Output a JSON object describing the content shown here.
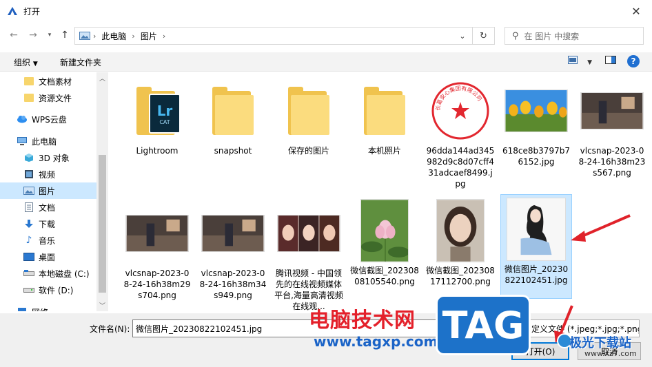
{
  "window": {
    "title": "打开"
  },
  "address": {
    "segments": [
      "此电脑",
      "图片"
    ]
  },
  "search": {
    "placeholder": "在 图片 中搜索"
  },
  "toolbar": {
    "organize": "组织",
    "new_folder": "新建文件夹"
  },
  "sidebar": {
    "items": [
      {
        "label": "文档素材",
        "icon": "folder-icon"
      },
      {
        "label": "资源文件",
        "icon": "folder-icon"
      },
      {
        "label": "WPS云盘",
        "icon": "cloud-icon"
      },
      {
        "label": "此电脑",
        "icon": "computer-icon"
      },
      {
        "label": "3D 对象",
        "icon": "cube-icon"
      },
      {
        "label": "视频",
        "icon": "video-icon"
      },
      {
        "label": "图片",
        "icon": "pictures-icon",
        "selected": true
      },
      {
        "label": "文档",
        "icon": "document-icon"
      },
      {
        "label": "下载",
        "icon": "download-icon"
      },
      {
        "label": "音乐",
        "icon": "music-icon"
      },
      {
        "label": "桌面",
        "icon": "desktop-icon"
      },
      {
        "label": "本地磁盘 (C:)",
        "icon": "drive-icon"
      },
      {
        "label": "软件 (D:)",
        "icon": "drive-icon"
      },
      {
        "label": "网络",
        "icon": "network-icon"
      }
    ]
  },
  "files": [
    {
      "label": "Lightroom",
      "kind": "folder-lr"
    },
    {
      "label": "snapshot",
      "kind": "folder"
    },
    {
      "label": "保存的图片",
      "kind": "folder"
    },
    {
      "label": "本机照片",
      "kind": "folder"
    },
    {
      "label": "96dda144ad345982d9c8d07cff431adcaef8499.jpg",
      "kind": "seal"
    },
    {
      "label": "618ce8b3797b76152.jpg",
      "kind": "tulips"
    },
    {
      "label": "vlcsnap-2023-08-24-16h38m23s567.png",
      "kind": "room"
    },
    {
      "label": "vlcsnap-2023-08-24-16h38m29s704.png",
      "kind": "room"
    },
    {
      "label": "vlcsnap-2023-08-24-16h38m34s949.png",
      "kind": "room"
    },
    {
      "label": "腾讯视频 - 中国领先的在线视频媒体平台,海量高清视频 在线观...",
      "kind": "faces"
    },
    {
      "label": "微信截图_20230808105540.png",
      "kind": "lotus"
    },
    {
      "label": "微信截图_20230817112700.png",
      "kind": "portrait"
    },
    {
      "label": "微信图片_20230822102451.jpg",
      "kind": "drawing",
      "selected": true
    }
  ],
  "seal_text": "长葛安心集团有限公司",
  "bottom": {
    "filename_label": "文件名(N):",
    "filename_value": "微信图片_20230822102451.jpg",
    "filter": "自定义文件 (*.jpeg;*.jpg;*.png",
    "open": "打开(O)",
    "cancel": "取消"
  },
  "watermark": {
    "red_text": "电脑技术网",
    "url": "www.tagxp.com",
    "tag": "TAG",
    "site_name": "极光下载站",
    "site_url": "www.xz7.com"
  }
}
